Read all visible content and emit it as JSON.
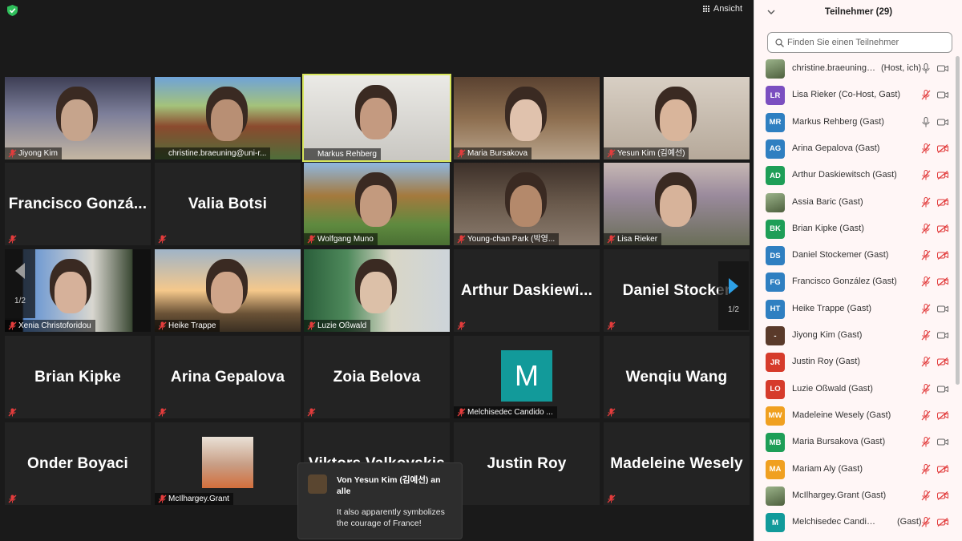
{
  "toolbar": {
    "view_label": "Ansicht"
  },
  "gallery": {
    "page_indicator_left": "1/2",
    "page_indicator_right": "1/2",
    "tiles": [
      {
        "name": "Jiyong Kim",
        "video": true,
        "muted": true
      },
      {
        "name": "christine.braeuning@uni-r...",
        "video": true,
        "muted": false
      },
      {
        "name": "Markus Rehberg",
        "video": true,
        "muted": false,
        "active": true
      },
      {
        "name": "Maria Bursakova",
        "video": true,
        "muted": true
      },
      {
        "name": "Yesun Kim (김예선)",
        "video": true,
        "muted": true
      },
      {
        "name": "Francisco  Gonzá...",
        "video": false,
        "muted": true
      },
      {
        "name": "Valia Botsi",
        "video": false,
        "muted": true
      },
      {
        "name": "Wolfgang Muno",
        "video": true,
        "muted": true
      },
      {
        "name": "Young-chan Park (박영...",
        "video": true,
        "muted": true
      },
      {
        "name": "Lisa Rieker",
        "video": true,
        "muted": true
      },
      {
        "name": "Xenia Christoforidou",
        "video": true,
        "muted": true
      },
      {
        "name": "Heike Trappe",
        "video": true,
        "muted": true
      },
      {
        "name": "Luzie Oßwald",
        "video": true,
        "muted": true
      },
      {
        "name": "Arthur  Daskiewi...",
        "video": false,
        "muted": true
      },
      {
        "name": "Daniel Stocker",
        "video": false,
        "muted": true
      },
      {
        "name": "Brian Kipke",
        "video": false,
        "muted": true
      },
      {
        "name": "Arina Gepalova",
        "video": false,
        "muted": true
      },
      {
        "name": "Zoia Belova",
        "video": false,
        "muted": true
      },
      {
        "name": "Melchisedec Candido ...",
        "video": false,
        "muted": true,
        "avatar_letter": "M"
      },
      {
        "name": "Wenqiu Wang",
        "video": false,
        "muted": true
      },
      {
        "name": "Onder Boyaci",
        "video": false,
        "muted": true
      },
      {
        "name": "McIlhargey.Grant",
        "video": true,
        "muted": true
      },
      {
        "name": "Viktors Valkovskis",
        "video": false,
        "muted": false
      },
      {
        "name": "Justin Roy",
        "video": false,
        "muted": false
      },
      {
        "name": "Madeleine Wesely",
        "video": false,
        "muted": true
      }
    ]
  },
  "chat_popup": {
    "from": "Von Yesun Kim (김예선) an alle",
    "message": "It also apparently symbolizes the courage of France!"
  },
  "participants": {
    "title": "Teilnehmer (29)",
    "search_placeholder": "Finden Sie einen Teilnehmer",
    "list": [
      {
        "initials": "",
        "color": "#6b8f5a",
        "name": "christine.braeuning@...",
        "role": "(Host, ich)",
        "mic": "on",
        "cam": "on",
        "photo": true
      },
      {
        "initials": "LR",
        "color": "#7b4fc0",
        "name": "Lisa Rieker (Co-Host, Gast)",
        "role": "",
        "mic": "off",
        "cam": "on"
      },
      {
        "initials": "MR",
        "color": "#2f7fc1",
        "name": "Markus Rehberg (Gast)",
        "role": "",
        "mic": "on",
        "cam": "on"
      },
      {
        "initials": "AG",
        "color": "#2f7fc1",
        "name": "Arina Gepalova (Gast)",
        "role": "",
        "mic": "off",
        "cam": "off"
      },
      {
        "initials": "AD",
        "color": "#1e9e57",
        "name": "Arthur Daskiewitsch (Gast)",
        "role": "",
        "mic": "off",
        "cam": "off"
      },
      {
        "initials": "",
        "color": "#4a6ea8",
        "name": "Assia Baric (Gast)",
        "role": "",
        "mic": "off",
        "cam": "off",
        "photo": true
      },
      {
        "initials": "BK",
        "color": "#1e9e57",
        "name": "Brian Kipke (Gast)",
        "role": "",
        "mic": "off",
        "cam": "off"
      },
      {
        "initials": "DS",
        "color": "#2f7fc1",
        "name": "Daniel Stockemer (Gast)",
        "role": "",
        "mic": "off",
        "cam": "off"
      },
      {
        "initials": "FG",
        "color": "#2f7fc1",
        "name": "Francisco González (Gast)",
        "role": "",
        "mic": "off",
        "cam": "off"
      },
      {
        "initials": "HT",
        "color": "#2f7fc1",
        "name": "Heike Trappe (Gast)",
        "role": "",
        "mic": "off",
        "cam": "on"
      },
      {
        "initials": "-",
        "color": "#5a3a2a",
        "name": "Jiyong Kim (Gast)",
        "role": "",
        "mic": "off",
        "cam": "on"
      },
      {
        "initials": "JR",
        "color": "#d63b2b",
        "name": "Justin Roy (Gast)",
        "role": "",
        "mic": "off",
        "cam": "off"
      },
      {
        "initials": "LO",
        "color": "#d63b2b",
        "name": "Luzie Oßwald (Gast)",
        "role": "",
        "mic": "off",
        "cam": "on"
      },
      {
        "initials": "MW",
        "color": "#f0a020",
        "name": "Madeleine Wesely (Gast)",
        "role": "",
        "mic": "off",
        "cam": "off"
      },
      {
        "initials": "MB",
        "color": "#1e9e57",
        "name": "Maria Bursakova (Gast)",
        "role": "",
        "mic": "off",
        "cam": "on"
      },
      {
        "initials": "MA",
        "color": "#f0a020",
        "name": "Mariam Aly (Gast)",
        "role": "",
        "mic": "off",
        "cam": "off"
      },
      {
        "initials": "",
        "color": "#8a7a6a",
        "name": "McIlhargey.Grant (Gast)",
        "role": "",
        "mic": "off",
        "cam": "off",
        "photo": true
      },
      {
        "initials": "M",
        "color": "#129a9a",
        "name": "Melchisedec Candido Peli...",
        "role": "(Gast)",
        "mic": "off",
        "cam": "off"
      }
    ]
  }
}
